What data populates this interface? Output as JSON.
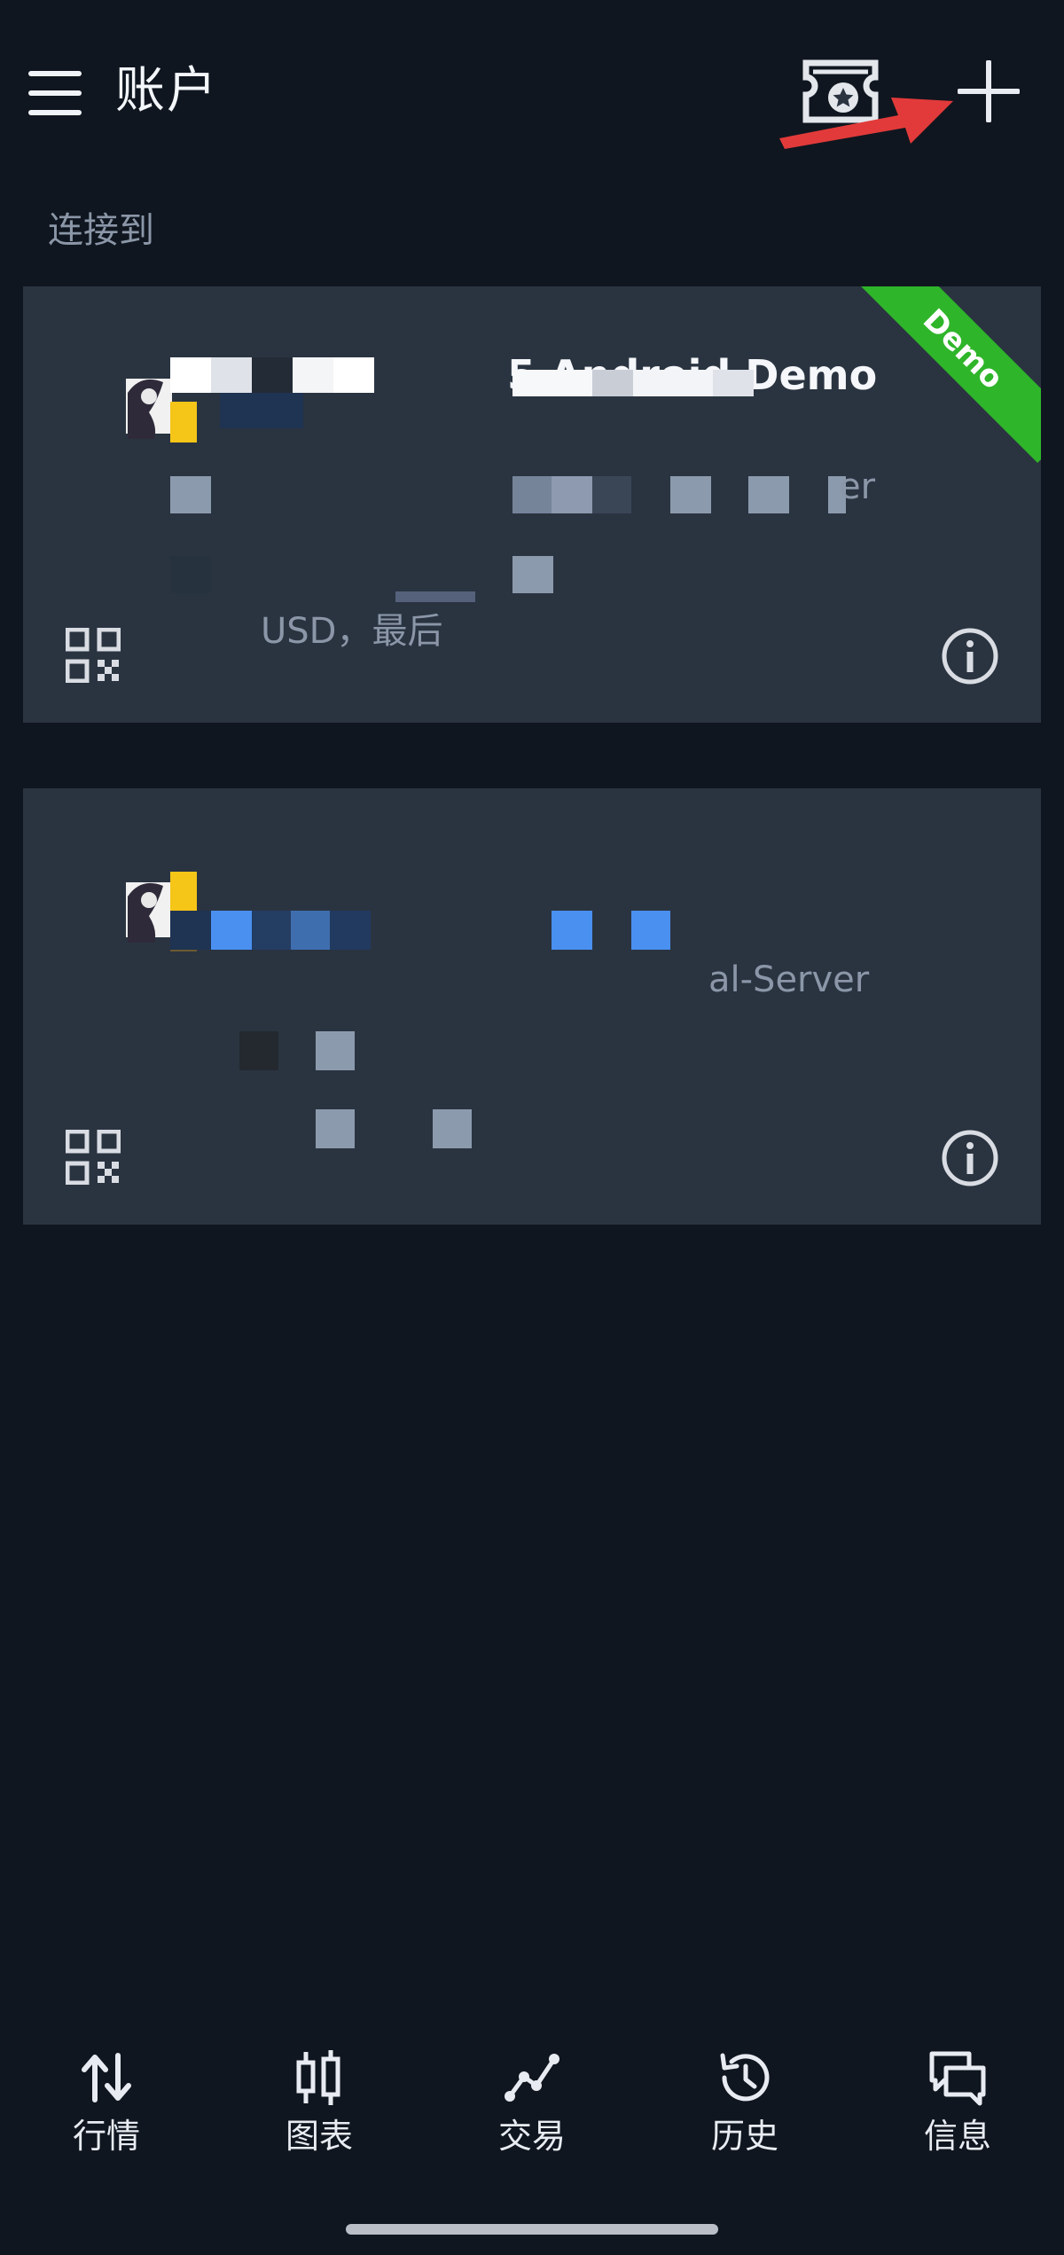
{
  "header": {
    "title": "账户"
  },
  "section": {
    "connected_label": "连接到"
  },
  "accounts": [
    {
      "title": "5 Android Demo",
      "server_suffix": "er",
      "balance_text": "USD，最后",
      "badge": "Demo"
    },
    {
      "server_suffix": "al-Server"
    }
  ],
  "bottom_nav": [
    {
      "label": "行情",
      "icon": "quotes-arrows-icon"
    },
    {
      "label": "图表",
      "icon": "chart-candles-icon"
    },
    {
      "label": "交易",
      "icon": "trade-line-icon"
    },
    {
      "label": "历史",
      "icon": "history-clock-icon"
    },
    {
      "label": "信息",
      "icon": "messages-bubbles-icon"
    }
  ],
  "colors": {
    "background": "#10161f",
    "card": "#2a3441",
    "demo_badge": "#2fb52a",
    "annotation_arrow": "#e23a3a"
  }
}
